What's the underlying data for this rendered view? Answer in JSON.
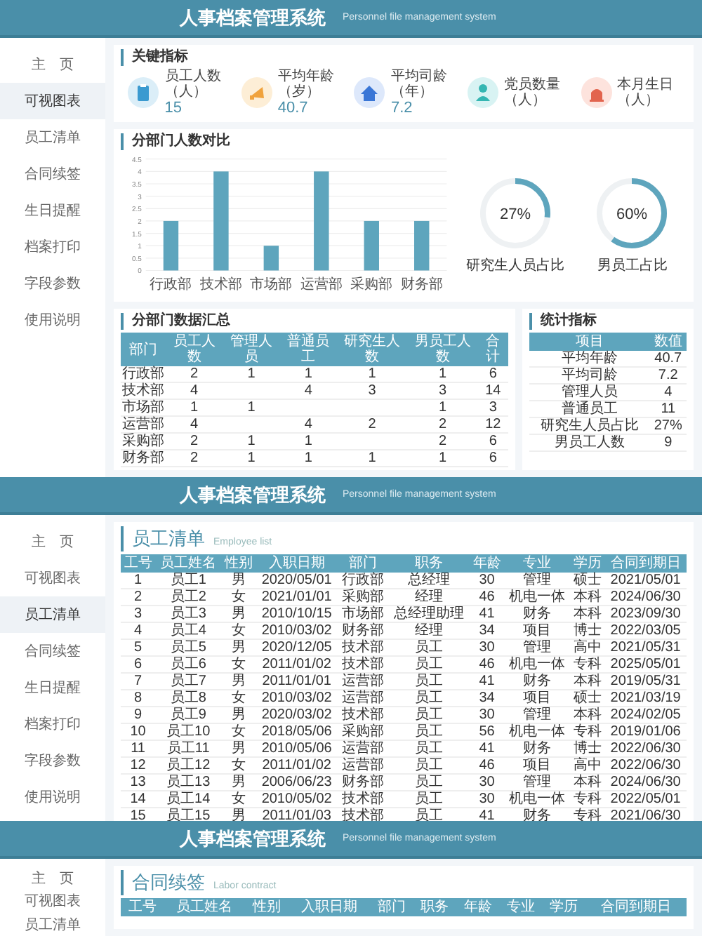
{
  "screens": [
    {
      "kind": "dashboard",
      "header": {
        "title": "人事档案管理系统",
        "subtitle": "Personnel file management system"
      },
      "sidebar": [
        {
          "label": "主　页",
          "selected": false
        },
        {
          "label": "可视图表",
          "selected": true
        },
        {
          "label": "员工清单",
          "selected": false
        },
        {
          "label": "合同续签",
          "selected": false
        },
        {
          "label": "生日提醒",
          "selected": false
        },
        {
          "label": "档案打印",
          "selected": false
        },
        {
          "label": "字段参数",
          "selected": false
        },
        {
          "label": "使用说明",
          "selected": false
        }
      ],
      "kpi_card": {
        "title": "关键指标",
        "items": [
          {
            "label": "员工人数（人）",
            "value": "15"
          },
          {
            "label": "平均年龄（岁）",
            "value": "40.7"
          },
          {
            "label": "平均司龄（年）",
            "value": "7.2"
          },
          {
            "label": "党员数量（人）"
          },
          {
            "label": "本月生日（人）"
          }
        ]
      },
      "chart_card": {
        "title": "分部门人数对比",
        "chart_data": {
          "type": "bar",
          "grid": true,
          "categories": [
            "行政部",
            "技术部",
            "市场部",
            "运营部",
            "采购部",
            "财务部"
          ],
          "values": [
            2,
            4,
            1,
            4,
            2,
            2
          ],
          "ylim": [
            0,
            4.5
          ],
          "yticks": [
            0,
            0.5,
            1,
            1.5,
            2,
            2.5,
            3,
            3.5,
            4,
            4.5
          ]
        },
        "donuts": [
          {
            "value": "27%",
            "level": 0.27,
            "label": "研究生人员占比"
          },
          {
            "value": "60%",
            "level": 0.6,
            "label": "男员工占比"
          }
        ]
      },
      "dept_table": {
        "title": "分部门数据汇总",
        "columns": [
          "部门",
          "员工人数",
          "管理人员",
          "普通员工",
          "研究生人数",
          "男员工人数",
          "合计"
        ],
        "rows": [
          [
            "行政部",
            "2",
            "1",
            "1",
            "1",
            "1",
            "6"
          ],
          [
            "技术部",
            "4",
            "",
            "4",
            "3",
            "3",
            "14"
          ],
          [
            "市场部",
            "1",
            "1",
            "",
            "",
            "1",
            "3"
          ],
          [
            "运营部",
            "4",
            "",
            "4",
            "2",
            "2",
            "12"
          ],
          [
            "采购部",
            "2",
            "1",
            "1",
            "",
            "2",
            "6"
          ],
          [
            "财务部",
            "2",
            "1",
            "1",
            "1",
            "1",
            "6"
          ]
        ]
      },
      "stats_table": {
        "title": "统计指标",
        "columns": [
          "项目",
          "数值"
        ],
        "rows": [
          [
            "平均年龄",
            "40.7"
          ],
          [
            "平均司龄",
            "7.2"
          ],
          [
            "管理人员",
            "4"
          ],
          [
            "普通员工",
            "11"
          ],
          [
            "研究生人员占比",
            "27%"
          ],
          [
            "男员工人数",
            "9"
          ]
        ]
      }
    },
    {
      "kind": "employees",
      "header": {
        "title": "人事档案管理系统",
        "subtitle": "Personnel file management system"
      },
      "sidebar": [
        {
          "label": "主　页",
          "selected": false
        },
        {
          "label": "可视图表",
          "selected": false
        },
        {
          "label": "员工清单",
          "selected": true
        },
        {
          "label": "合同续签",
          "selected": false
        },
        {
          "label": "生日提醒",
          "selected": false
        },
        {
          "label": "档案打印",
          "selected": false
        },
        {
          "label": "字段参数",
          "selected": false
        },
        {
          "label": "使用说明",
          "selected": false
        }
      ],
      "title": "员工清单",
      "subtitle": "Employee list",
      "table": {
        "columns": [
          "工号",
          "员工姓名",
          "性别",
          "入职日期",
          "部门",
          "职务",
          "年龄",
          "专业",
          "学历",
          "合同到期日"
        ],
        "rows": [
          [
            "1",
            "员工1",
            "男",
            "2020/05/01",
            "行政部",
            "总经理",
            "30",
            "管理",
            "硕士",
            "2021/05/01"
          ],
          [
            "2",
            "员工2",
            "女",
            "2021/01/01",
            "采购部",
            "经理",
            "46",
            "机电一体",
            "本科",
            "2024/06/30"
          ],
          [
            "3",
            "员工3",
            "男",
            "2010/10/15",
            "市场部",
            "总经理助理",
            "41",
            "财务",
            "本科",
            "2023/09/30"
          ],
          [
            "4",
            "员工4",
            "女",
            "2010/03/02",
            "财务部",
            "经理",
            "34",
            "项目",
            "博士",
            "2022/03/05"
          ],
          [
            "5",
            "员工5",
            "男",
            "2020/12/05",
            "技术部",
            "员工",
            "30",
            "管理",
            "高中",
            "2021/05/31"
          ],
          [
            "6",
            "员工6",
            "女",
            "2011/01/02",
            "技术部",
            "员工",
            "46",
            "机电一体",
            "专科",
            "2025/05/01"
          ],
          [
            "7",
            "员工7",
            "男",
            "2011/01/01",
            "运营部",
            "员工",
            "41",
            "财务",
            "本科",
            "2019/05/31"
          ],
          [
            "8",
            "员工8",
            "女",
            "2010/03/02",
            "运营部",
            "员工",
            "34",
            "项目",
            "硕士",
            "2021/03/19"
          ],
          [
            "9",
            "员工9",
            "男",
            "2020/03/02",
            "技术部",
            "员工",
            "30",
            "管理",
            "本科",
            "2024/02/05"
          ],
          [
            "10",
            "员工10",
            "女",
            "2018/05/06",
            "采购部",
            "员工",
            "56",
            "机电一体",
            "专科",
            "2019/01/06"
          ],
          [
            "11",
            "员工11",
            "男",
            "2010/05/06",
            "运营部",
            "员工",
            "41",
            "财务",
            "博士",
            "2022/06/30"
          ],
          [
            "12",
            "员工12",
            "女",
            "2011/01/02",
            "运营部",
            "员工",
            "46",
            "项目",
            "高中",
            "2022/06/30"
          ],
          [
            "13",
            "员工13",
            "男",
            "2006/06/23",
            "财务部",
            "员工",
            "30",
            "管理",
            "本科",
            "2024/06/30"
          ],
          [
            "14",
            "员工14",
            "女",
            "2010/05/02",
            "技术部",
            "员工",
            "30",
            "机电一体",
            "专科",
            "2022/05/01"
          ],
          [
            "15",
            "员工15",
            "男",
            "2011/01/03",
            "技术部",
            "员工",
            "41",
            "财务",
            "专科",
            "2021/06/30"
          ]
        ]
      }
    },
    {
      "kind": "contracts",
      "header": {
        "title": "人事档案管理系统",
        "subtitle": "Personnel file management system"
      },
      "sidebar": [
        {
          "label": "主　页",
          "selected": false
        },
        {
          "label": "可视图表",
          "selected": false
        },
        {
          "label": "员工清单",
          "selected": false
        }
      ],
      "title": "合同续签",
      "subtitle": "Labor contract",
      "table": {
        "columns": [
          "工号",
          "员工姓名",
          "性别",
          "入职日期",
          "部门",
          "职务",
          "年龄",
          "专业",
          "学历",
          "合同到期日"
        ]
      }
    }
  ]
}
